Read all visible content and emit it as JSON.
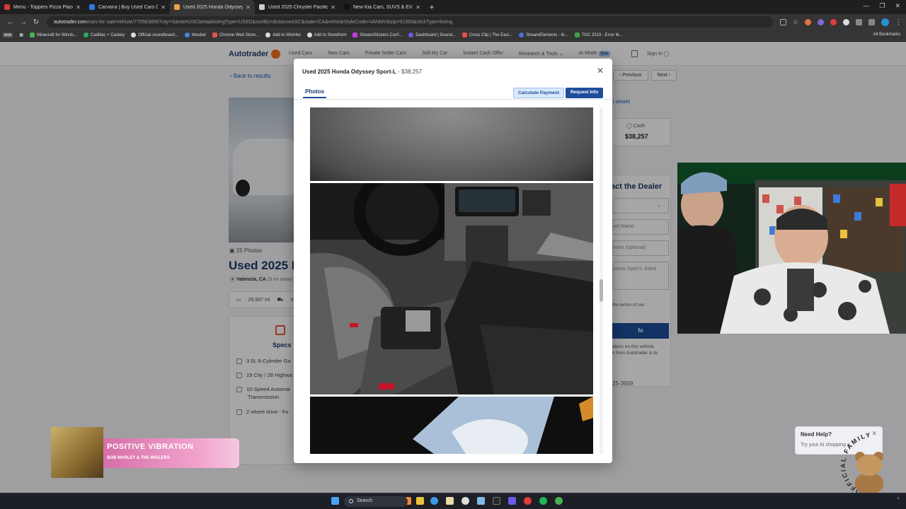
{
  "browser": {
    "tabs": [
      {
        "label": "Menu - Toppers Pizza Place",
        "color": "#d93a3a"
      },
      {
        "label": "Carvana | Buy Used Cars Online",
        "color": "#2c7be5"
      },
      {
        "label": "Used 2025 Honda Odyssey Sport",
        "color": "#f1a04a"
      },
      {
        "label": "Used 2025 Chrysler Pacifica",
        "color": "#cccccc"
      },
      {
        "label": "New Kia Cars, SUVS & EVs For",
        "color": "#111111"
      }
    ],
    "url_host": "autotrader.com",
    "url_path": "/cars-for-sale/vehicle/770583856?city=Santa%20Clarita&listingType=USED&sortBy=distanceASC&state=CA&vehicleStyleCode=VANMV&zip=91350&clickType=listing",
    "bookmarks": [
      "kick",
      "Minecraft for Windo...",
      "Cadillac + Caskey",
      "Official soundboard...",
      "Moobot",
      "Chrome Web Store...",
      "Add to Wishlist",
      "Add to Storefront",
      "StreamStickers Conf...",
      "Dashboard | Sound...",
      "Cross Clip | The Easi...",
      "StreamElements - th...",
      "TGC 2019 - Error M..."
    ],
    "all_bookmarks": "All Bookmarks"
  },
  "site": {
    "logo": "Autotrader",
    "nav": [
      "Used Cars",
      "New Cars",
      "Private Seller Cars",
      "Sell My Car",
      "Instant Cash Offer",
      "Research & Tools",
      "AI Mode"
    ],
    "nav_beta": "Beta",
    "signin": "Sign In",
    "back": "Back to results",
    "prev": "Previous",
    "next": "Next",
    "photos_count": "25 Photos",
    "title": "Used 2025 H",
    "location": "Valencia, CA",
    "distance": "(3 mi away)",
    "mileage": "29,507 mi",
    "ve": "Ve",
    "specs_title": "Specs",
    "specs": [
      "3.5L 6-Cylinder Ga",
      "19 City / 28 Highwa",
      "10-Speed Automat",
      "Transmission",
      "2 wheel drive - fro"
    ],
    "details_link": "t details",
    "price_type": "Cash",
    "price": "$38,257",
    "contact_title": "act the Dealer",
    "fields": [
      "ast Name",
      "hone (optional)",
      "yssey Sport-L listed"
    ],
    "terms": "the terms of our",
    "contact_btn": "fo",
    "alerts": [
      "alerts on this vehicle",
      "n from Autotrader & its"
    ],
    "phone": "25-3659"
  },
  "modal": {
    "title": "Used 2025 Honda Odyssey Sport-L",
    "price": " - $38,257",
    "tab": "Photos",
    "calc_btn": "Calculate Payment",
    "req_btn": "Request Info"
  },
  "music": {
    "song": "POSITIVE VIBRATION",
    "artist": "BOB MARLEY & THE WAILERS"
  },
  "help": {
    "title": "Need Help?",
    "subtitle": "Try your AI shopping a"
  },
  "badge_text": "UNOFFICIAL FAMILY",
  "taskbar": {
    "search": "Search"
  }
}
